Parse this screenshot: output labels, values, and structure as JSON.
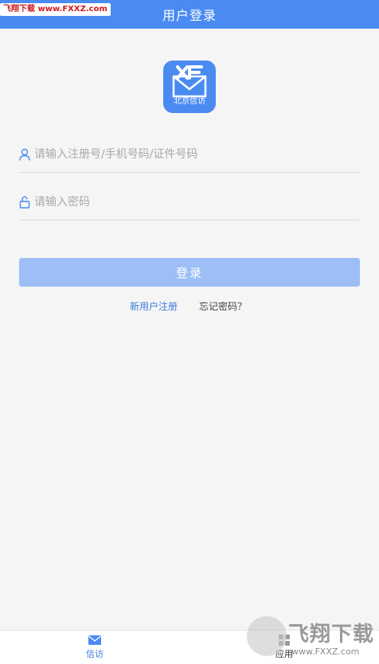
{
  "header": {
    "title": "用户登录",
    "watermark": "飞翔下载 www.FXXZ.com"
  },
  "logo": {
    "text": "北京信访",
    "icon": "envelope-xf-logo-icon"
  },
  "form": {
    "username_placeholder": "请输入注册号/手机号码/证件号码",
    "username_value": "",
    "password_placeholder": "请输入密码",
    "password_value": "",
    "login_label": "登录",
    "register_label": "新用户注册",
    "forgot_label": "忘记密码？"
  },
  "bottom_nav": {
    "items": [
      {
        "label": "信访",
        "icon": "mail-icon",
        "active": true
      },
      {
        "label": "应用",
        "icon": "apps-icon",
        "active": false
      }
    ]
  },
  "watermark_bottom": {
    "name": "飞翔下载",
    "url": "www.FXXZ.com"
  },
  "colors": {
    "primary": "#4a8bf2",
    "button_disabled": "#9dbff6",
    "link": "#3d7be0",
    "background": "#f5f5f5"
  }
}
